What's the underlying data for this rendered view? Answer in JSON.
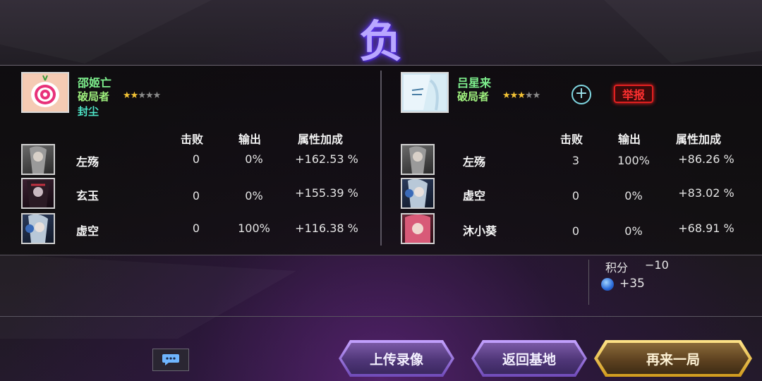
{
  "result_glyph": "负",
  "left_player": {
    "name": "邵姬亡",
    "rank": "破局者",
    "stars_on": "★★",
    "stars_off": "★★★",
    "tag": "封尘"
  },
  "right_player": {
    "name": "吕星来",
    "rank": "破局者",
    "stars_on": "★★★",
    "stars_off": "★★",
    "add_friend_icon": "+",
    "report_label": "举报"
  },
  "headers": {
    "kills": "击败",
    "output": "输出",
    "bonus": "属性加成"
  },
  "left_heroes": [
    {
      "name": "左殇",
      "kills": "0",
      "output": "0%",
      "bonus": "+162.53 %"
    },
    {
      "name": "玄玉",
      "kills": "0",
      "output": "0%",
      "bonus": "+155.39 %"
    },
    {
      "name": "虚空",
      "kills": "0",
      "output": "100%",
      "bonus": "+116.38 %"
    }
  ],
  "right_heroes": [
    {
      "name": "左殇",
      "kills": "3",
      "output": "100%",
      "bonus": "+86.26 %"
    },
    {
      "name": "虚空",
      "kills": "0",
      "output": "0%",
      "bonus": "+83.02 %"
    },
    {
      "name": "沐小葵",
      "kills": "0",
      "output": "0%",
      "bonus": "+68.91 %"
    }
  ],
  "score": {
    "label": "积分",
    "value": "−10",
    "gem_value": "+35"
  },
  "buttons": {
    "upload": "上传录像",
    "return": "返回基地",
    "again": "再来一局"
  },
  "colors": {
    "name_green": "#7ef08e",
    "tag_cyan": "#4fe6c8",
    "report_red": "#e02020",
    "gold": "#f5c435"
  }
}
